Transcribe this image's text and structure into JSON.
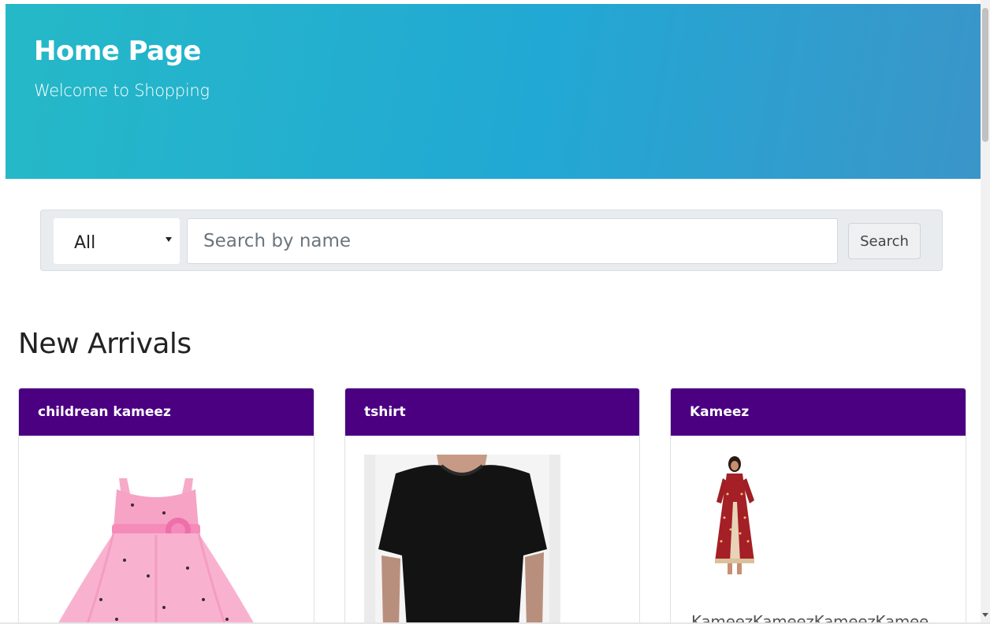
{
  "hero": {
    "title": "Home Page",
    "subtitle": "Welcome to Shopping"
  },
  "search": {
    "category_selected": "All",
    "placeholder": "Search by name",
    "button_label": "Search"
  },
  "section": {
    "title": "New Arrivals"
  },
  "products": [
    {
      "name": "childrean kameez",
      "description": "",
      "image": "pink-dress-image"
    },
    {
      "name": "tshirt",
      "description": "",
      "image": "black-tshirt-image"
    },
    {
      "name": "Kameez",
      "description": "KameezKameezKameezKamee",
      "image": "red-kameez-image"
    }
  ],
  "colors": {
    "hero_gradient_start": "#25b9c7",
    "hero_gradient_end": "#3b95c9",
    "card_header": "#4b0082",
    "search_bar_bg": "#e9ecef"
  }
}
